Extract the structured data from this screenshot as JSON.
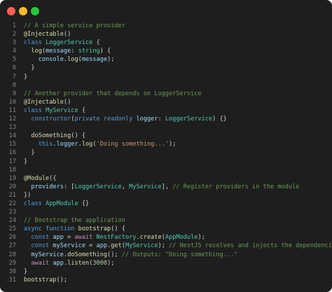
{
  "window": {
    "controls": [
      "close",
      "minimize",
      "maximize"
    ]
  },
  "colors": {
    "background": "#1e1e1e",
    "comment": "#6a9955",
    "keyword": "#569cd6",
    "control": "#c586c0",
    "class": "#4ec9b0",
    "function": "#dcdcaa",
    "variable": "#9cdcfe",
    "string": "#ce9178",
    "number": "#b5cea8"
  },
  "code_lines": [
    {
      "n": "1",
      "tokens": [
        {
          "t": "// A simple service provider",
          "c": "cm"
        }
      ]
    },
    {
      "n": "2",
      "tokens": [
        {
          "t": "@Injectable",
          "c": "fn"
        },
        {
          "t": "()",
          "c": ""
        }
      ]
    },
    {
      "n": "3",
      "tokens": [
        {
          "t": "class",
          "c": "kw"
        },
        {
          "t": " ",
          "c": ""
        },
        {
          "t": "LoggerService",
          "c": "cls"
        },
        {
          "t": " {",
          "c": ""
        }
      ]
    },
    {
      "n": "4",
      "tokens": [
        {
          "t": "  ",
          "c": ""
        },
        {
          "t": "log",
          "c": "fn"
        },
        {
          "t": "(",
          "c": ""
        },
        {
          "t": "message",
          "c": "var"
        },
        {
          "t": ": ",
          "c": ""
        },
        {
          "t": "string",
          "c": "cls"
        },
        {
          "t": ") {",
          "c": ""
        }
      ]
    },
    {
      "n": "5",
      "tokens": [
        {
          "t": "    ",
          "c": ""
        },
        {
          "t": "console",
          "c": "var"
        },
        {
          "t": ".",
          "c": ""
        },
        {
          "t": "log",
          "c": "fn"
        },
        {
          "t": "(",
          "c": ""
        },
        {
          "t": "message",
          "c": "var"
        },
        {
          "t": ");",
          "c": ""
        }
      ]
    },
    {
      "n": "6",
      "tokens": [
        {
          "t": "  }",
          "c": ""
        }
      ]
    },
    {
      "n": "7",
      "tokens": [
        {
          "t": "}",
          "c": ""
        }
      ]
    },
    {
      "n": "8",
      "tokens": []
    },
    {
      "n": "9",
      "tokens": [
        {
          "t": "// Another provider that depends on LoggerService",
          "c": "cm"
        }
      ]
    },
    {
      "n": "10",
      "tokens": [
        {
          "t": "@Injectable",
          "c": "fn"
        },
        {
          "t": "()",
          "c": ""
        }
      ]
    },
    {
      "n": "11",
      "tokens": [
        {
          "t": "class",
          "c": "kw"
        },
        {
          "t": " ",
          "c": ""
        },
        {
          "t": "MyService",
          "c": "cls"
        },
        {
          "t": " {",
          "c": ""
        }
      ]
    },
    {
      "n": "12",
      "tokens": [
        {
          "t": "  ",
          "c": ""
        },
        {
          "t": "constructor",
          "c": "kw"
        },
        {
          "t": "(",
          "c": ""
        },
        {
          "t": "private",
          "c": "kw"
        },
        {
          "t": " ",
          "c": ""
        },
        {
          "t": "readonly",
          "c": "kw"
        },
        {
          "t": " ",
          "c": ""
        },
        {
          "t": "logger",
          "c": "var"
        },
        {
          "t": ": ",
          "c": ""
        },
        {
          "t": "LoggerService",
          "c": "cls"
        },
        {
          "t": ") {}",
          "c": ""
        }
      ]
    },
    {
      "n": "13",
      "tokens": []
    },
    {
      "n": "14",
      "tokens": [
        {
          "t": "  ",
          "c": ""
        },
        {
          "t": "doSomething",
          "c": "fn"
        },
        {
          "t": "() {",
          "c": ""
        }
      ]
    },
    {
      "n": "15",
      "tokens": [
        {
          "t": "    ",
          "c": ""
        },
        {
          "t": "this",
          "c": "kw"
        },
        {
          "t": ".",
          "c": ""
        },
        {
          "t": "logger",
          "c": "var"
        },
        {
          "t": ".",
          "c": ""
        },
        {
          "t": "log",
          "c": "fn"
        },
        {
          "t": "(",
          "c": ""
        },
        {
          "t": "'Doing something...'",
          "c": "str"
        },
        {
          "t": ");",
          "c": ""
        }
      ]
    },
    {
      "n": "16",
      "tokens": [
        {
          "t": "  }",
          "c": ""
        }
      ]
    },
    {
      "n": "17",
      "tokens": [
        {
          "t": "}",
          "c": ""
        }
      ]
    },
    {
      "n": "18",
      "tokens": []
    },
    {
      "n": "19",
      "tokens": [
        {
          "t": "@Module",
          "c": "fn"
        },
        {
          "t": "({",
          "c": ""
        }
      ]
    },
    {
      "n": "20",
      "tokens": [
        {
          "t": "  ",
          "c": ""
        },
        {
          "t": "providers",
          "c": "var"
        },
        {
          "t": ": [",
          "c": ""
        },
        {
          "t": "LoggerService",
          "c": "cls"
        },
        {
          "t": ", ",
          "c": ""
        },
        {
          "t": "MyService",
          "c": "cls"
        },
        {
          "t": "], ",
          "c": ""
        },
        {
          "t": "// Register providers in the module",
          "c": "cm"
        }
      ]
    },
    {
      "n": "21",
      "tokens": [
        {
          "t": "})",
          "c": ""
        }
      ]
    },
    {
      "n": "22",
      "tokens": [
        {
          "t": "class",
          "c": "kw"
        },
        {
          "t": " ",
          "c": ""
        },
        {
          "t": "AppModule",
          "c": "cls"
        },
        {
          "t": " {}",
          "c": ""
        }
      ]
    },
    {
      "n": "23",
      "tokens": []
    },
    {
      "n": "24",
      "tokens": [
        {
          "t": "// Bootstrap the application",
          "c": "cm"
        }
      ]
    },
    {
      "n": "25",
      "tokens": [
        {
          "t": "async",
          "c": "kw"
        },
        {
          "t": " ",
          "c": ""
        },
        {
          "t": "function",
          "c": "kw"
        },
        {
          "t": " ",
          "c": ""
        },
        {
          "t": "bootstrap",
          "c": "fn"
        },
        {
          "t": "() {",
          "c": ""
        }
      ]
    },
    {
      "n": "26",
      "tokens": [
        {
          "t": "  ",
          "c": ""
        },
        {
          "t": "const",
          "c": "kw"
        },
        {
          "t": " ",
          "c": ""
        },
        {
          "t": "app",
          "c": "var"
        },
        {
          "t": " = ",
          "c": ""
        },
        {
          "t": "await",
          "c": "kc"
        },
        {
          "t": " ",
          "c": ""
        },
        {
          "t": "NestFactory",
          "c": "cls"
        },
        {
          "t": ".",
          "c": ""
        },
        {
          "t": "create",
          "c": "fn"
        },
        {
          "t": "(",
          "c": ""
        },
        {
          "t": "AppModule",
          "c": "cls"
        },
        {
          "t": ");",
          "c": ""
        }
      ]
    },
    {
      "n": "27",
      "tokens": [
        {
          "t": "  ",
          "c": ""
        },
        {
          "t": "const",
          "c": "kw"
        },
        {
          "t": " ",
          "c": ""
        },
        {
          "t": "myService",
          "c": "var"
        },
        {
          "t": " = ",
          "c": ""
        },
        {
          "t": "app",
          "c": "var"
        },
        {
          "t": ".",
          "c": ""
        },
        {
          "t": "get",
          "c": "fn"
        },
        {
          "t": "(",
          "c": ""
        },
        {
          "t": "MyService",
          "c": "cls"
        },
        {
          "t": "); ",
          "c": ""
        },
        {
          "t": "// NestJS resolves and injects the dependencies",
          "c": "cm"
        }
      ]
    },
    {
      "n": "28",
      "tokens": [
        {
          "t": "  ",
          "c": ""
        },
        {
          "t": "myService",
          "c": "var"
        },
        {
          "t": ".",
          "c": ""
        },
        {
          "t": "doSomething",
          "c": "fn"
        },
        {
          "t": "(); ",
          "c": ""
        },
        {
          "t": "// Outputs: \"Doing something...\"",
          "c": "cm"
        }
      ]
    },
    {
      "n": "29",
      "tokens": [
        {
          "t": "  ",
          "c": ""
        },
        {
          "t": "await",
          "c": "kc"
        },
        {
          "t": " ",
          "c": ""
        },
        {
          "t": "app",
          "c": "var"
        },
        {
          "t": ".",
          "c": ""
        },
        {
          "t": "listen",
          "c": "fn"
        },
        {
          "t": "(",
          "c": ""
        },
        {
          "t": "3000",
          "c": "num"
        },
        {
          "t": ");",
          "c": ""
        }
      ]
    },
    {
      "n": "30",
      "tokens": [
        {
          "t": "}",
          "c": ""
        }
      ]
    },
    {
      "n": "31",
      "tokens": [
        {
          "t": "bootstrap",
          "c": "fn"
        },
        {
          "t": "();",
          "c": ""
        }
      ]
    }
  ]
}
